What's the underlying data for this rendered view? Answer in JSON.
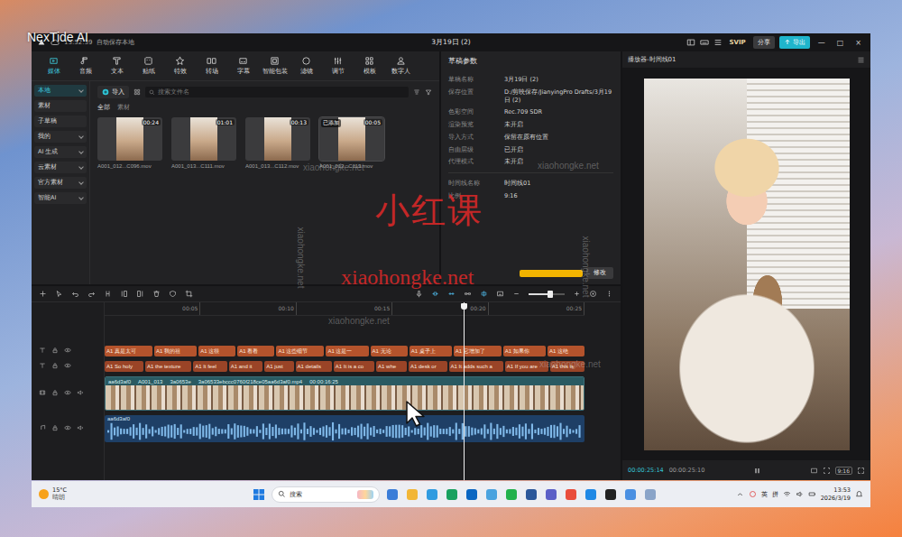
{
  "watermarks": {
    "brand": "NexTide AI",
    "title": "小红课",
    "url": "xiaohongke.net",
    "faint": [
      "xiaohongke.net",
      "xiaohongke.net",
      "xiaohongke.net",
      "xiaohongke.net",
      "xiaohongke.net",
      "xiaohongke.net"
    ]
  },
  "window": {
    "autosave_time": "13:52:39",
    "autosave_label": "自动保存本地",
    "title": "3月19日 (2)",
    "svip": "SVIP",
    "share": "分享",
    "export": "导出",
    "controls": [
      "—",
      "□",
      "×"
    ]
  },
  "toolbar": [
    {
      "label": "媒体",
      "selected": true
    },
    {
      "label": "音频",
      "selected": false
    },
    {
      "label": "文本",
      "selected": false
    },
    {
      "label": "贴纸",
      "selected": false
    },
    {
      "label": "特效",
      "selected": false
    },
    {
      "label": "转场",
      "selected": false
    },
    {
      "label": "字幕",
      "selected": false
    },
    {
      "label": "智能包装",
      "selected": false
    },
    {
      "label": "滤镜",
      "selected": false
    },
    {
      "label": "调节",
      "selected": false
    },
    {
      "label": "模板",
      "selected": false
    },
    {
      "label": "数字人",
      "selected": false
    }
  ],
  "sidebar": [
    {
      "label": "本地",
      "selected": true,
      "expandable": true
    },
    {
      "label": "素材",
      "selected": false,
      "expandable": false
    },
    {
      "label": "子草稿",
      "selected": false,
      "expandable": false
    },
    {
      "label": "我的",
      "selected": false,
      "expandable": true
    },
    {
      "label": "AI 生成",
      "selected": false,
      "expandable": true
    },
    {
      "label": "云素材",
      "selected": false,
      "expandable": true
    },
    {
      "label": "官方素材",
      "selected": false,
      "expandable": true
    },
    {
      "label": "智能AI",
      "selected": false,
      "expandable": true
    }
  ],
  "media": {
    "import": "导入",
    "search_placeholder": "搜索文件名",
    "added_label": "已添加",
    "filters": [
      {
        "label": "全部",
        "selected": true
      },
      {
        "label": "素材",
        "selected": false
      }
    ],
    "clips": [
      {
        "duration": "00:24",
        "name": "A001_012...C096.mov",
        "added": false
      },
      {
        "duration": "01:01",
        "name": "A001_013...C111.mov",
        "added": false
      },
      {
        "duration": "00:13",
        "name": "A001_013...C112.mov",
        "added": false
      },
      {
        "duration": "00:05",
        "name": "A001_013...C113.mov",
        "added": true
      }
    ]
  },
  "draft": {
    "title": "草稿参数",
    "rows": [
      {
        "label": "草稿名称",
        "value": "3月19日 (2)"
      },
      {
        "label": "保存位置",
        "value": "D:/剪映保存/JianyingPro Drafts/3月19日 (2)"
      },
      {
        "label": "色彩空间",
        "value": "Rec.709 SDR"
      },
      {
        "label": "渲染预览",
        "value": "未开启"
      },
      {
        "label": "导入方式",
        "value": "保留在原有位置"
      },
      {
        "label": "自由层级",
        "value": "已开启"
      },
      {
        "label": "代理模式",
        "value": "未开启"
      }
    ],
    "timeline_rows": [
      {
        "label": "时间线名称",
        "value": "时间线01"
      },
      {
        "label": "比例",
        "value": "9:16"
      }
    ],
    "button": "修改"
  },
  "timeline": {
    "ruler": [
      "00:05",
      "00:10",
      "00:15",
      "00:20",
      "00:25"
    ],
    "playhead": 0.696,
    "zoom": 0.6,
    "tracks": [
      {
        "kind": "text",
        "clips": [
          "A1 真是太可",
          "A1 我的祖",
          "A1 这很",
          "A1 看看",
          "A1 这些细节",
          "A1 这是一",
          "A1 无论",
          "A1 桌子上",
          "A1 它增加了",
          "A1 如果你",
          "A1 这绝"
        ]
      },
      {
        "kind": "text",
        "clips": [
          "A1 So holy",
          "A1 the texture",
          "A1 It feel",
          "A1 and it",
          "A1 just",
          "A1 details",
          "A1 It is a co",
          "A1 whe",
          "A1 desk or",
          "A1 It adds such a",
          "A1 If you are",
          "A1 this is"
        ]
      },
      {
        "kind": "video",
        "clips": [
          "aa6d3af0",
          "A001_013",
          "3a0653e",
          "3a06533ebccc0760f218ce05aa6d3af0.mp4",
          "00:00:16:25"
        ]
      },
      {
        "kind": "audio",
        "clips": [
          "aa6d3af0"
        ]
      }
    ]
  },
  "player": {
    "title": "播放器-时间线01",
    "current": "00:00:25:14",
    "total": "00:00:25:10",
    "ratio": "9:16"
  },
  "taskbar": {
    "temp": "15°C",
    "weather": "晴朗",
    "search": "搜索",
    "tray": [
      "英",
      "拼"
    ],
    "time": "13:53",
    "date": "2026/3/19"
  }
}
